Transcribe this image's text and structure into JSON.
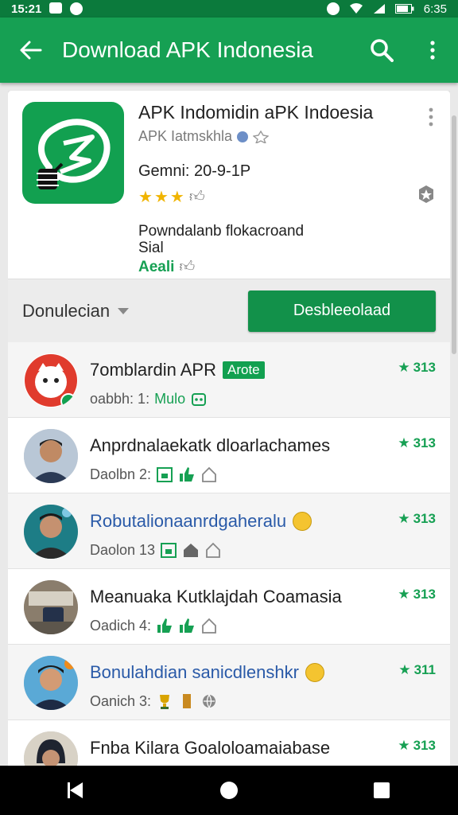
{
  "status_bar": {
    "time": "15:21",
    "right_time": "6:35"
  },
  "app_bar": {
    "title": "Download APK Indonesia"
  },
  "app_header": {
    "name": "APK Indomidin aPK Indoesia",
    "developer": "APK  Iatmskhla",
    "version": "Gemni: 20-9-1P",
    "rating_stars": 3,
    "description_line1": "Powndalanb flokacroand",
    "description_line2": "Sial",
    "tag": "Aeali"
  },
  "action_bar": {
    "dropdown_label": "Donulecian",
    "button_label": "Desbleeolaad"
  },
  "list": [
    {
      "title": "7omblardin APR",
      "badge": "Arote",
      "sub_prefix": "oabbh: 1:",
      "sub_accent": "Mulo",
      "score": "313",
      "blue": false
    },
    {
      "title": "Anprdnalaekatk dloarlachames",
      "badge": "",
      "sub_prefix": "Daolbn  2:",
      "sub_accent": "",
      "score": "313",
      "blue": false
    },
    {
      "title": "Robutalionaanrdgaheralu",
      "badge": "",
      "sub_prefix": "Daolon 13",
      "sub_accent": "",
      "score": "313",
      "blue": true
    },
    {
      "title": "Meanuaka Kutklajdah Coamasia",
      "badge": "",
      "sub_prefix": "Oadich 4:",
      "sub_accent": "",
      "score": "313",
      "blue": false
    },
    {
      "title": "Bonulahdian sanicdlenshkr",
      "badge": "",
      "sub_prefix": "Oanich  3:",
      "sub_accent": "",
      "score": "311",
      "blue": true
    },
    {
      "title": "Fnba Kilara Goaloloamaiabase",
      "badge": "",
      "sub_prefix": "",
      "sub_accent": "",
      "score": "313",
      "blue": false
    }
  ],
  "colors": {
    "primary": "#16a053",
    "status_bar": "#0b7a3c",
    "accent_blue": "#2a5aa8"
  }
}
